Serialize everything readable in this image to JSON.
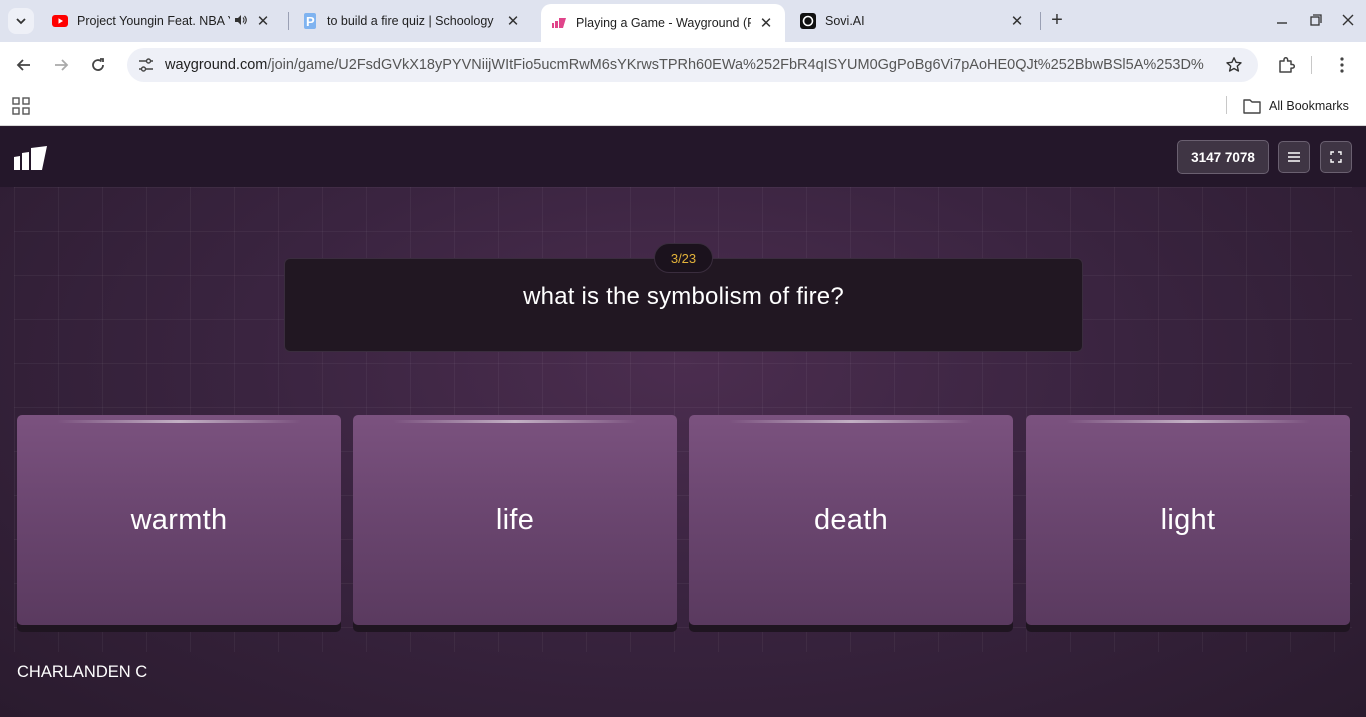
{
  "browser": {
    "tabs": [
      {
        "title": "Project Youngin Feat. NBA Y",
        "favicon": "youtube-icon",
        "sound": true
      },
      {
        "title": "to build a fire quiz | Schoology",
        "favicon": "schoology-icon"
      },
      {
        "title": "Playing a Game - Wayground (F",
        "favicon": "wayground-icon",
        "active": true
      },
      {
        "title": "Sovi.AI",
        "favicon": "sovi-icon"
      }
    ],
    "url_host": "wayground.com",
    "url_path": "/join/game/U2FsdGVkX18yPYVNiijWItFio5ucmRwM6sYKrwsTPRh60EWa%252FbR4qISYUM0GgPoBg6Vi7pAoHE0QJt%252BbwBSl5A%253D%…",
    "bookmarks_label": "All Bookmarks"
  },
  "game": {
    "join_code": "3147 7078",
    "progress": "3/23",
    "question": "what is the symbolism of fire?",
    "answers": [
      "warmth",
      "life",
      "death",
      "light"
    ],
    "player_name": "CHARLANDEN C"
  },
  "colors": {
    "accent_counter": "#e2b23a",
    "answer_tile": "#6b4670",
    "background": "#2a1b2e"
  }
}
